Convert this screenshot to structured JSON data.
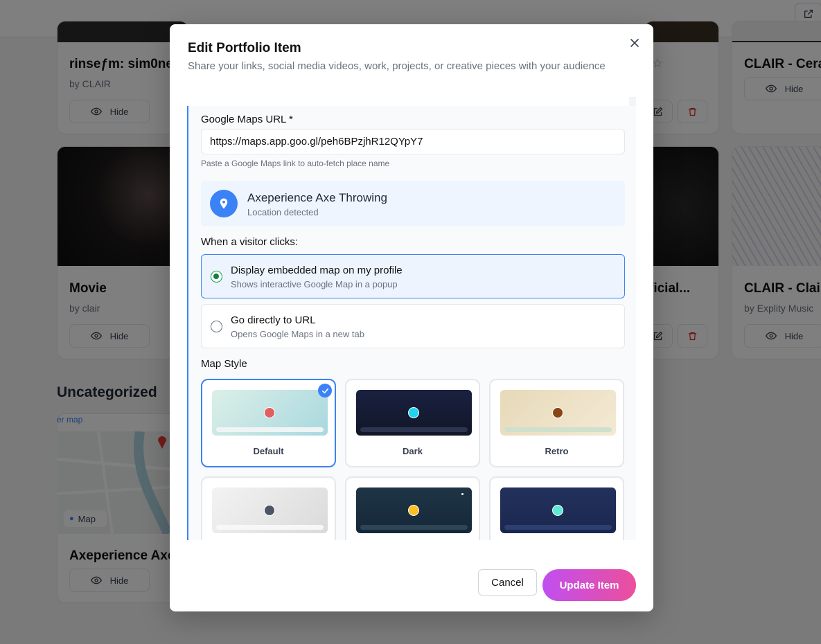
{
  "background": {
    "cards": [
      {
        "title": "rinseƒm: sim0ne",
        "subtitle": "by CLAIR",
        "hide_label": "Hide"
      },
      {
        "title": "CLAIR - Cera",
        "hide_label": "Hide"
      },
      {
        "title": "Movie",
        "subtitle": "by clair",
        "hide_label": "Hide"
      },
      {
        "title": "ficial...",
        "hide_label": ""
      },
      {
        "title": "CLAIR - Clair",
        "subtitle": "by Explity Music",
        "hide_label": "Hide"
      },
      {
        "title": "Axeperience Axe",
        "hide_label": "Hide"
      }
    ],
    "section_title": "Uncategorized",
    "map_link": "er map",
    "map_chip": "Map"
  },
  "modal": {
    "title": "Edit Portfolio Item",
    "description": "Share your links, social media videos, work, projects, or creative pieces with your audience",
    "url_label": "Google Maps URL *",
    "url_value": "https://maps.app.goo.gl/peh6BPzjhR12QYpY7",
    "url_hint": "Paste a Google Maps link to auto-fetch place name",
    "place": {
      "name": "Axeperience Axe Throwing",
      "status": "Location detected"
    },
    "visitor_label": "When a visitor clicks:",
    "options": [
      {
        "title": "Display embedded map on my profile",
        "subtitle": "Shows interactive Google Map in a popup",
        "selected": true
      },
      {
        "title": "Go directly to URL",
        "subtitle": "Opens Google Maps in a new tab",
        "selected": false
      }
    ],
    "map_style_label": "Map Style",
    "styles": [
      {
        "name": "Default",
        "selected": true,
        "dot_color": "#e06060"
      },
      {
        "name": "Dark",
        "selected": false,
        "dot_color": "#22d3ee"
      },
      {
        "name": "Retro",
        "selected": false,
        "dot_color": "#8b4513"
      },
      {
        "name": "",
        "selected": false,
        "dot_color": "#4b5563"
      },
      {
        "name": "",
        "selected": false,
        "dot_color": "#fbbf24"
      },
      {
        "name": "",
        "selected": false,
        "dot_color": "#5eead4"
      }
    ],
    "cancel_label": "Cancel",
    "update_label": "Update Item"
  },
  "colors": {
    "accent": "#3b82f6",
    "radio_selected": "#15803d",
    "update_gradient_start": "#c04ff0",
    "update_gradient_end": "#ec4f9c"
  }
}
